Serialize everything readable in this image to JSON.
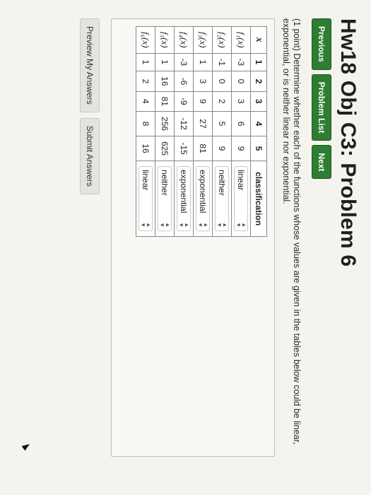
{
  "page": {
    "title": "Hw18 Obj C3: Problem 6"
  },
  "nav": {
    "previous": "Previous",
    "problem_list": "Problem List",
    "next": "Next"
  },
  "problem": {
    "text": "(1 point) Determine whether each of the functions whose values are given in the tables below could be linear, exponential, or is neither linear nor exponential."
  },
  "table": {
    "x_header": "x",
    "classification_header": "classification",
    "x_values": [
      "1",
      "2",
      "3",
      "4",
      "5"
    ],
    "rows": [
      {
        "name": "f₁(x)",
        "values": [
          "-3",
          "0",
          "3",
          "6",
          "9"
        ],
        "classification": "linear"
      },
      {
        "name": "f₂(x)",
        "values": [
          "-1",
          "0",
          "2",
          "5",
          "9"
        ],
        "classification": "neither"
      },
      {
        "name": "f₃(x)",
        "values": [
          "1",
          "3",
          "9",
          "27",
          "81"
        ],
        "classification": "exponential"
      },
      {
        "name": "f₄(x)",
        "values": [
          "-3",
          "-6",
          "-9",
          "-12",
          "-15"
        ],
        "classification": "exponential"
      },
      {
        "name": "f₅(x)",
        "values": [
          "1",
          "16",
          "81",
          "256",
          "625"
        ],
        "classification": "neither"
      },
      {
        "name": "f₆(x)",
        "values": [
          "1",
          "2",
          "4",
          "8",
          "16"
        ],
        "classification": "linear"
      }
    ]
  },
  "footer": {
    "preview": "Preview My Answers",
    "submit": "Submit Answers"
  },
  "colors": {
    "primary_button": "#2e7d32",
    "secondary_button": "#e4e3dd"
  },
  "icons": {
    "select_arrows": "up-down-chevron-icon",
    "pointer": "mouse-cursor-icon"
  }
}
